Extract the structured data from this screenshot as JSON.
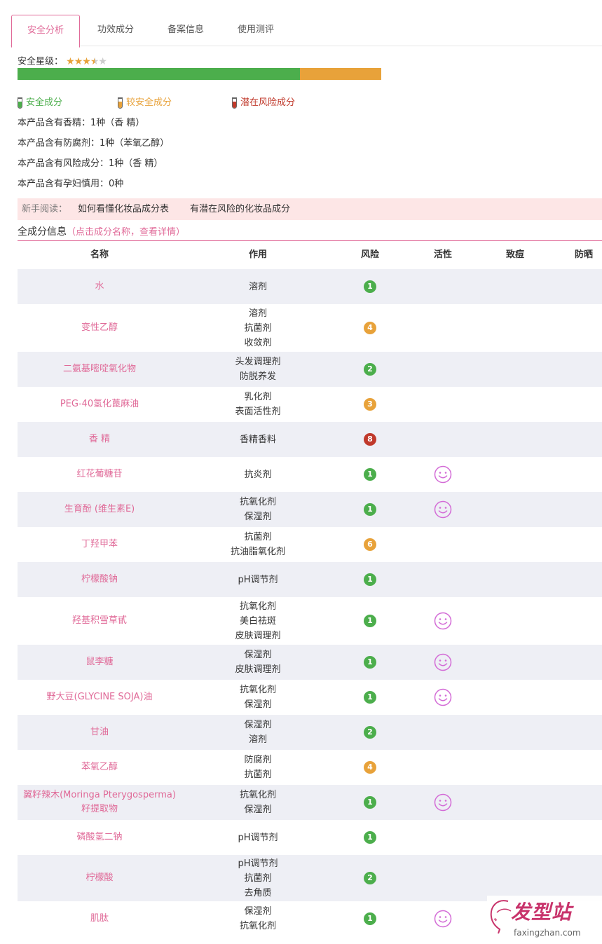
{
  "tabs": [
    {
      "label": "安全分析",
      "active": true
    },
    {
      "label": "功效成分",
      "active": false
    },
    {
      "label": "备案信息",
      "active": false
    },
    {
      "label": "使用测评",
      "active": false
    }
  ],
  "rating": {
    "label": "安全星级：",
    "stars": 3.5,
    "max": 5
  },
  "safety_bar": {
    "safe_fraction": 0.777,
    "medium_fraction": 0.223
  },
  "legend": [
    {
      "label": "安全成分",
      "color": "#4cae4c"
    },
    {
      "label": "较安全成分",
      "color": "#e8a23a"
    },
    {
      "label": "潜在风险成分",
      "color": "#c0392b"
    }
  ],
  "stats": [
    "本产品含有香精：1种（香 精）",
    "本产品含有防腐剂：1种（苯氧乙醇）",
    "本产品含有风险成分：1种（香 精）",
    "本产品含有孕妇慎用：0种"
  ],
  "guide": {
    "label": "新手阅读：",
    "link1": "如何看懂化妆品成分表",
    "link2": "有潜在风险的化妆品成分"
  },
  "section": {
    "title": "全成分信息",
    "hint": "（点击成分名称，查看详情）"
  },
  "table": {
    "headers": [
      "名称",
      "作用",
      "风险",
      "活性",
      "致痘",
      "防晒"
    ],
    "rows": [
      {
        "name": "水",
        "funcs": [
          "溶剂"
        ],
        "risk": "1",
        "active": false
      },
      {
        "name": "变性乙醇",
        "funcs": [
          "溶剂",
          "抗菌剂",
          "收敛剂"
        ],
        "risk": "4",
        "active": false
      },
      {
        "name": "二氨基嘧啶氧化物",
        "funcs": [
          "头发调理剂",
          "防脱养发"
        ],
        "risk": "2",
        "active": false
      },
      {
        "name": "PEG-40氢化蓖麻油",
        "funcs": [
          "乳化剂",
          "表面活性剂"
        ],
        "risk": "3",
        "active": false
      },
      {
        "name": "香 精",
        "funcs": [
          "香精香料"
        ],
        "risk": "8",
        "active": false
      },
      {
        "name": "红花葡糖苷",
        "funcs": [
          "抗炎剂"
        ],
        "risk": "1",
        "active": true
      },
      {
        "name": "生育酚 (维生素E)",
        "funcs": [
          "抗氧化剂",
          "保湿剂"
        ],
        "risk": "1",
        "active": true
      },
      {
        "name": "丁羟甲苯",
        "funcs": [
          "抗菌剂",
          "抗油脂氧化剂"
        ],
        "risk": "6",
        "active": false
      },
      {
        "name": "柠檬酸钠",
        "funcs": [
          "pH调节剂"
        ],
        "risk": "1",
        "active": false
      },
      {
        "name": "羟基积雪草甙",
        "funcs": [
          "抗氧化剂",
          "美白祛斑",
          "皮肤调理剂"
        ],
        "risk": "1",
        "active": true
      },
      {
        "name": "鼠李糖",
        "funcs": [
          "保湿剂",
          "皮肤调理剂"
        ],
        "risk": "1",
        "active": true
      },
      {
        "name": "野大豆(GLYCINE SOJA)油",
        "funcs": [
          "抗氧化剂",
          "保湿剂"
        ],
        "risk": "1",
        "active": true
      },
      {
        "name": "甘油",
        "funcs": [
          "保湿剂",
          "溶剂"
        ],
        "risk": "2",
        "active": false
      },
      {
        "name": "苯氧乙醇",
        "funcs": [
          "防腐剂",
          "抗菌剂"
        ],
        "risk": "4",
        "active": false
      },
      {
        "name": "翼籽辣木(Moringa Pterygosperma)籽提取物",
        "funcs": [
          "抗氧化剂",
          "保湿剂"
        ],
        "risk": "1",
        "active": true
      },
      {
        "name": "磷酸氢二钠",
        "funcs": [
          "pH调节剂"
        ],
        "risk": "1",
        "active": false
      },
      {
        "name": "柠檬酸",
        "funcs": [
          "pH调节剂",
          "抗菌剂",
          "去角质"
        ],
        "risk": "2",
        "active": false
      },
      {
        "name": "肌肽",
        "funcs": [
          "保湿剂",
          "抗氧化剂"
        ],
        "risk": "1",
        "active": true
      }
    ]
  },
  "risk_colors": {
    "safe": "#4cae4c",
    "medium": "#e8a23a",
    "high": "#c0392b"
  },
  "watermark": {
    "logo": "发型站",
    "url": "faxingzhan.com"
  }
}
